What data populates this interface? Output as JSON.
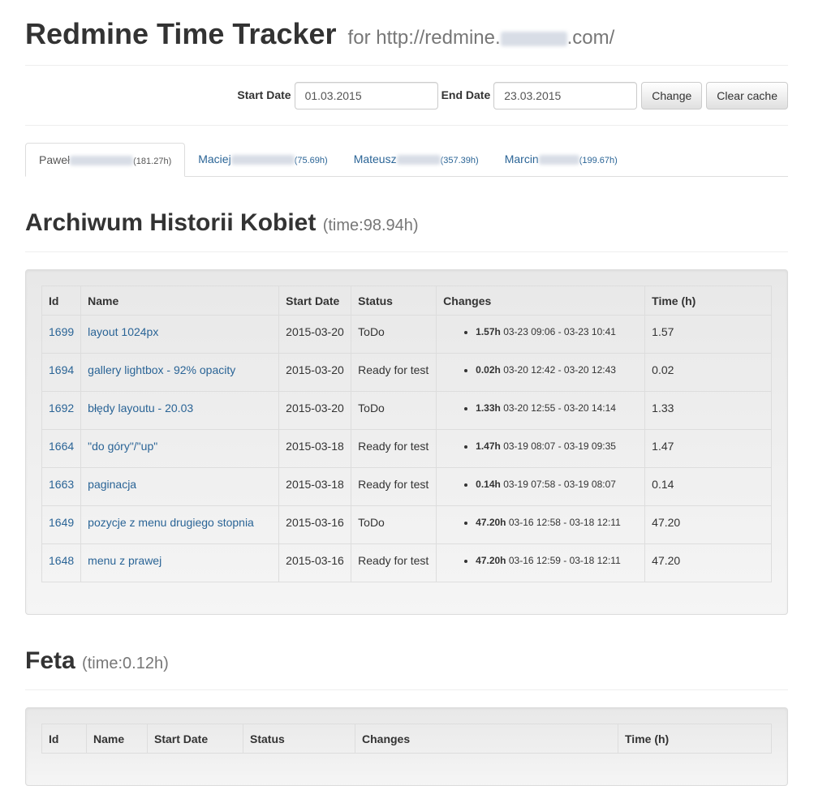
{
  "header": {
    "title": "Redmine Time Tracker",
    "subtitle_prefix": "for http://redmine.",
    "subtitle_suffix": ".com/"
  },
  "filter": {
    "start_label": "Start Date",
    "start_value": "01.03.2015",
    "end_label": "End Date",
    "end_value": "23.03.2015",
    "change_label": "Change",
    "clear_label": "Clear cache"
  },
  "tabs": [
    {
      "first": "Paweł",
      "hours": "(181.27h)",
      "active": true
    },
    {
      "first": "Maciej",
      "hours": "(75.69h)",
      "active": false
    },
    {
      "first": "Mateusz",
      "hours": "(357.39h)",
      "active": false
    },
    {
      "first": "Marcin",
      "hours": "(199.67h)",
      "active": false
    }
  ],
  "columns": [
    "Id",
    "Name",
    "Start Date",
    "Status",
    "Changes",
    "Time (h)"
  ],
  "projects": [
    {
      "name": "Archiwum Historii Kobiet",
      "time": "(time:98.94h)",
      "rows": [
        {
          "id": "1699",
          "name": "layout 1024px",
          "start": "2015-03-20",
          "status": "ToDo",
          "change_hours": "1.57h",
          "change_range": "03-23 09:06 - 03-23 10:41",
          "time": "1.57"
        },
        {
          "id": "1694",
          "name": "gallery lightbox - 92% opacity",
          "start": "2015-03-20",
          "status": "Ready for test",
          "change_hours": "0.02h",
          "change_range": "03-20 12:42 - 03-20 12:43",
          "time": "0.02"
        },
        {
          "id": "1692",
          "name": "błędy layoutu - 20.03",
          "start": "2015-03-20",
          "status": "ToDo",
          "change_hours": "1.33h",
          "change_range": "03-20 12:55 - 03-20 14:14",
          "time": "1.33"
        },
        {
          "id": "1664",
          "name": "\"do góry\"/\"up\"",
          "start": "2015-03-18",
          "status": "Ready for test",
          "change_hours": "1.47h",
          "change_range": "03-19 08:07 - 03-19 09:35",
          "time": "1.47"
        },
        {
          "id": "1663",
          "name": "paginacja",
          "start": "2015-03-18",
          "status": "Ready for test",
          "change_hours": "0.14h",
          "change_range": "03-19 07:58 - 03-19 08:07",
          "time": "0.14"
        },
        {
          "id": "1649",
          "name": "pozycje z menu drugiego stopnia",
          "start": "2015-03-16",
          "status": "ToDo",
          "change_hours": "47.20h",
          "change_range": "03-16 12:58 - 03-18 12:11",
          "time": "47.20"
        },
        {
          "id": "1648",
          "name": "menu z prawej",
          "start": "2015-03-16",
          "status": "Ready for test",
          "change_hours": "47.20h",
          "change_range": "03-16 12:59 - 03-18 12:11",
          "time": "47.20"
        }
      ]
    },
    {
      "name": "Feta",
      "time": "(time:0.12h)",
      "rows": []
    }
  ]
}
